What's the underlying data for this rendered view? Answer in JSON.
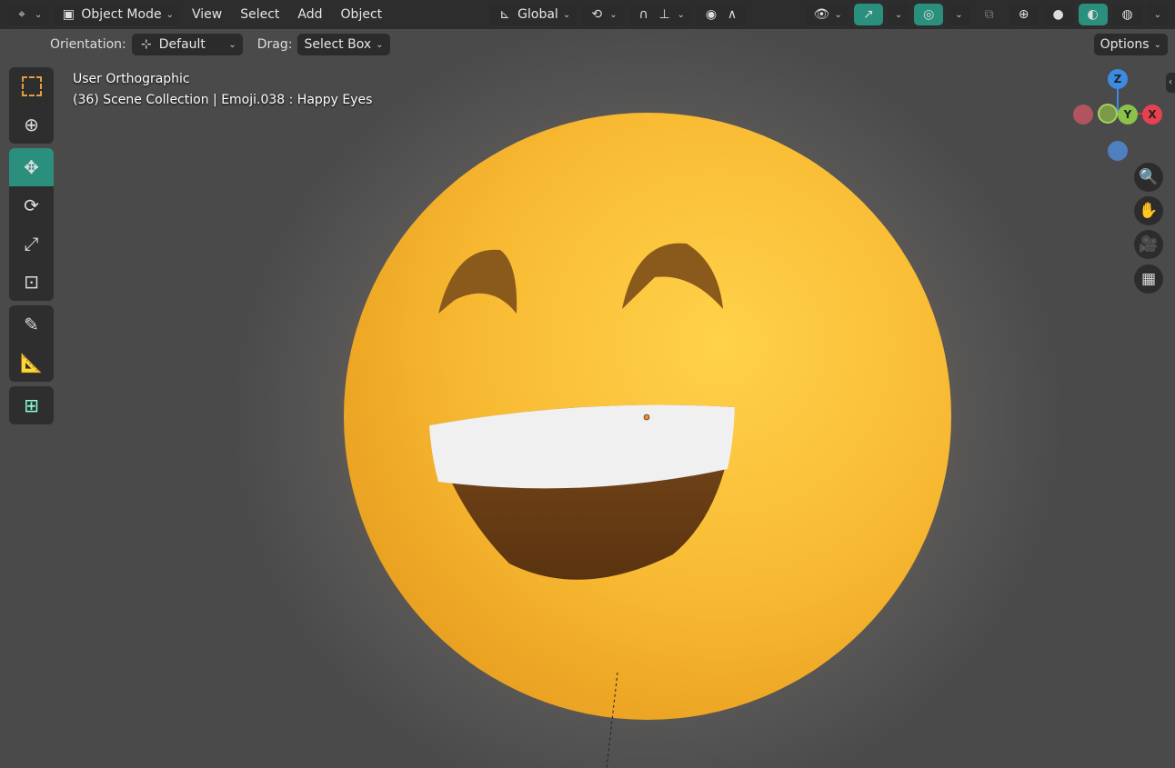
{
  "header": {
    "mode": "Object Mode",
    "menus": [
      "View",
      "Select",
      "Add",
      "Object"
    ],
    "transform_orientation": "Global"
  },
  "tool_settings": {
    "orientation_label": "Orientation:",
    "orientation_value": "Default",
    "drag_label": "Drag:",
    "drag_value": "Select Box",
    "options": "Options"
  },
  "overlay": {
    "view_name": "User Orthographic",
    "context": "(36) Scene Collection | Emoji.038 : Happy Eyes"
  },
  "gizmo": {
    "z": "Z",
    "y": "Y",
    "x": "X"
  },
  "colors": {
    "accent": "#2a8f7c",
    "x_axis": "#e8404f",
    "y_axis": "#8bc34a",
    "z_axis": "#3d8be0"
  }
}
